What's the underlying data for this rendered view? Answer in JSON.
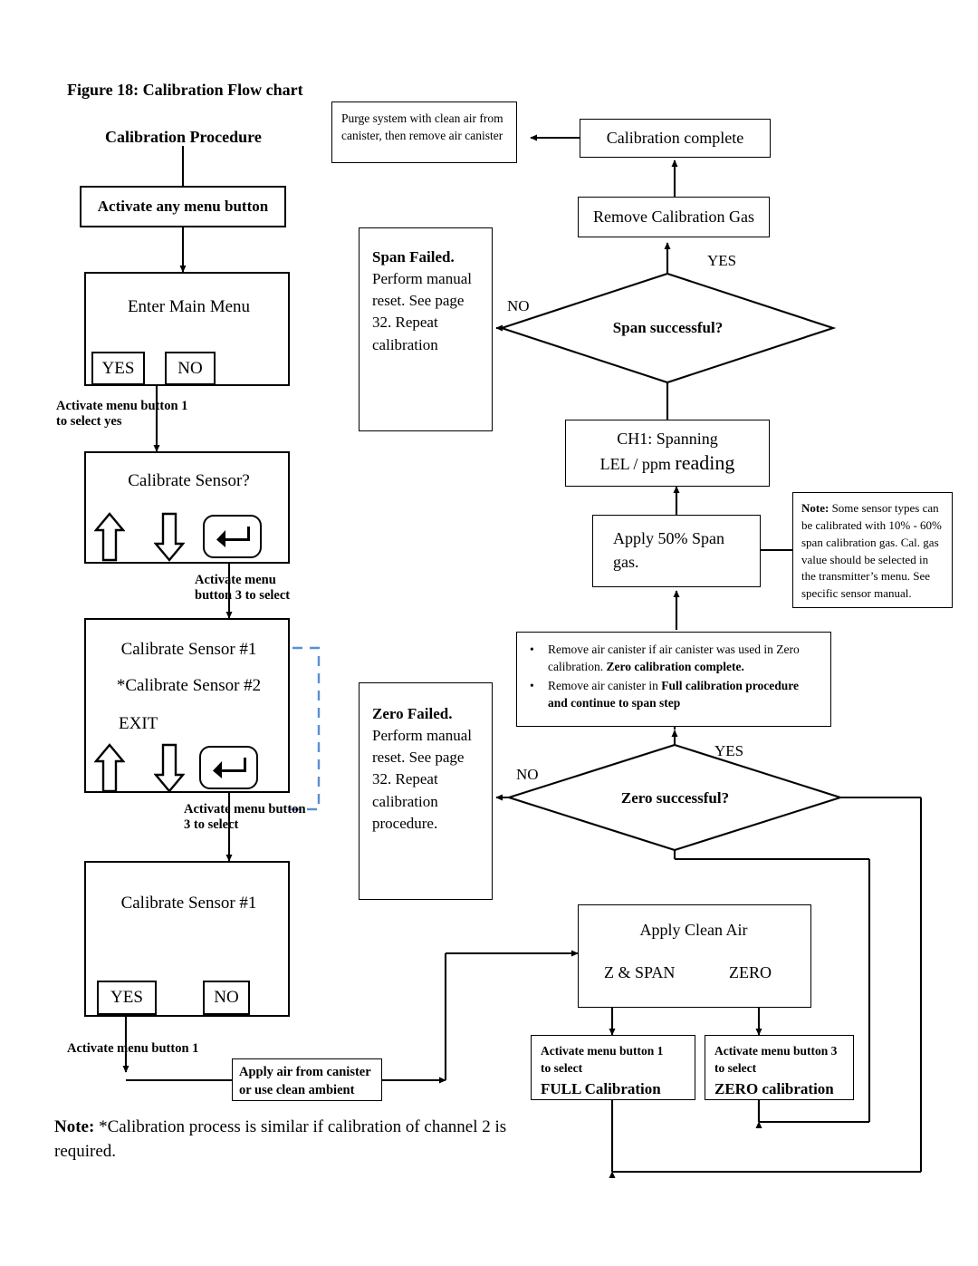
{
  "figure": {
    "caption": "Figure 18: Calibration Flow chart",
    "procedure_title": "Calibration Procedure"
  },
  "left_column": {
    "activate_any_menu_button": "Activate any menu button",
    "enter_main_menu": {
      "title": "Enter Main Menu",
      "yes": "YES",
      "no": "NO"
    },
    "label_activate_btn1_yes_line1": "Activate menu button 1",
    "label_activate_btn1_yes_line2": "to select yes",
    "calibrate_sensor_q": {
      "title": "Calibrate Sensor?",
      "up_icon": "up-arrow-icon",
      "down_icon": "down-arrow-icon",
      "enter_icon": "enter-key-icon"
    },
    "label_activate_btn3_line1": "Activate menu",
    "label_activate_btn3_line2": "button 3 to select",
    "sensor_menu": {
      "item_1": "Calibrate Sensor #1",
      "item_2": "*Calibrate Sensor #2",
      "item_3": "EXIT",
      "up_icon": "up-arrow-icon",
      "down_icon": "down-arrow-icon",
      "enter_icon": "enter-key-icon"
    },
    "label_activate_btn3_select_line1": "Activate menu button",
    "label_activate_btn3_select_line2": "3 to select",
    "calibrate_sensor_1": {
      "title": "Calibrate Sensor #1",
      "yes": "YES",
      "no": "NO"
    },
    "label_activate_btn1": "Activate menu button 1",
    "apply_air_line1": "Apply air from canister",
    "apply_air_line2": "or use clean ambient"
  },
  "right_column": {
    "purge_system": "Purge system with clean air from canister, then remove air canister",
    "calibration_complete": "Calibration complete",
    "remove_calibration_gas": "Remove Calibration Gas",
    "span_failed": {
      "bold": "Span Failed.",
      "rest": "Perform manual reset.  See page 32. Repeat calibration"
    },
    "span_successful": "Span successful?",
    "span_yes": "YES",
    "span_no": "NO",
    "ch1_spanning_line1": "CH1: Spanning",
    "ch1_spanning_line2a": "LEL / ppm ",
    "ch1_spanning_line2b": "reading",
    "apply_span_gas_line1": "Apply 50% Span",
    "apply_span_gas_line2": "gas.",
    "note_box": {
      "bold": "Note:",
      "rest": " Some sensor types can be calibrated with 10% - 60% span calibration gas. Cal. gas value should be selected in the transmitter’s menu. See specific sensor manual."
    },
    "bullets": [
      {
        "part1": "Remove air canister if air canister was used in Zero calibration. ",
        "part2_bold": "Zero calibration complete."
      },
      {
        "part1": "Remove air canister in ",
        "part2_bold": "Full calibration procedure and continue to span step"
      }
    ],
    "zero_failed": {
      "bold": "Zero Failed.",
      "rest": "Perform manual reset.  See page 32. Repeat calibration procedure."
    },
    "zero_successful": "Zero successful?",
    "zero_yes": "YES",
    "zero_no": "NO",
    "apply_clean_air": {
      "title": "Apply Clean Air",
      "left_option": "Z & SPAN",
      "right_option": "ZERO"
    },
    "full_cal": {
      "line1": "Activate menu button 1",
      "line2": "to select",
      "line3_bold": "FULL Calibration"
    },
    "zero_cal": {
      "line1": "Activate menu button 3",
      "line2": "to select",
      "line3_bold": "ZERO calibration"
    }
  },
  "footer_note": {
    "bold": "Note:",
    "rest": " *Calibration process is similar if calibration of channel 2 is required."
  },
  "colors": {
    "ink": "#000000",
    "highlight_dashed": "#5B8FD4",
    "background": "#ffffff"
  }
}
